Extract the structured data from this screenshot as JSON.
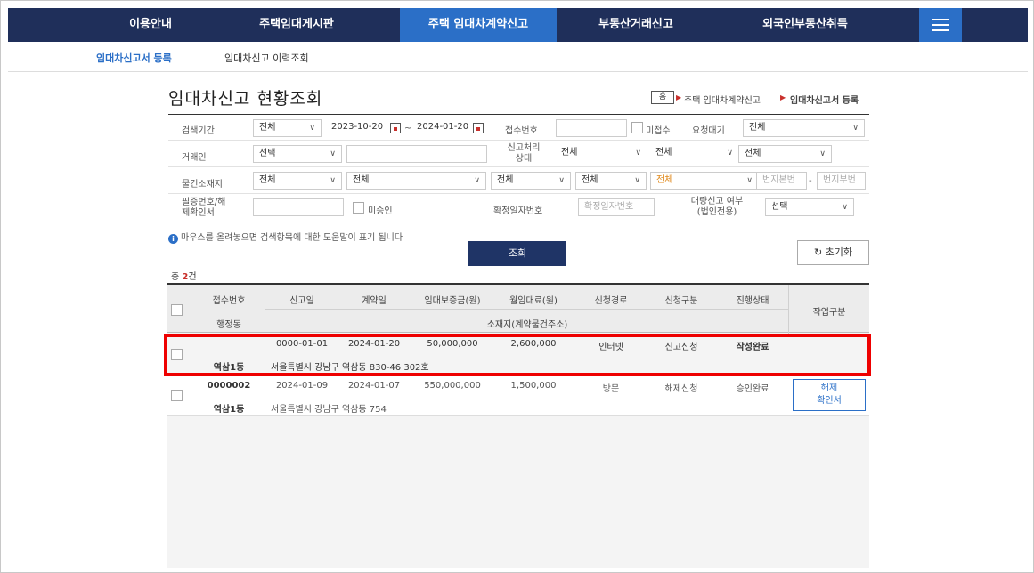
{
  "topnav": {
    "items": [
      "이용안내",
      "주택임대게시판",
      "주택 임대차계약신고",
      "부동산거래신고",
      "외국인부동산취득"
    ],
    "active_index": 2,
    "menu_icon": "hamburger-icon",
    "colors": {
      "bg": "#1f2f5a",
      "active": "#2b6fc7"
    }
  },
  "subnav": {
    "items": [
      "임대차신고서 등록",
      "임대차신고 이력조회"
    ],
    "active_index": 0
  },
  "page": {
    "title": "임대차신고 현황조회",
    "breadcrumb": {
      "home": "홈",
      "level1": "주택 임대차계약신고",
      "level2": "임대차신고서 등록"
    }
  },
  "search": {
    "period_label": "검색기간",
    "period_select": "전체",
    "date_from": "2023-10-20",
    "date_to": "2024-01-20",
    "tilde": "~",
    "receipt_label": "접수번호",
    "receipt_value": "",
    "unreceived_label": "미접수",
    "request_wait_label": "요청대기",
    "request_wait_select": "전체",
    "party_label": "거래인",
    "party_select": "선택",
    "party_value": "",
    "process_label": "신고처리 상태",
    "process_select1": "전체",
    "process_select2": "전체",
    "process_select3": "전체",
    "property_label": "물건소재지",
    "property_sido": "전체",
    "property_sigungu": "전체",
    "property_dong": "전체",
    "property_ri": "전체",
    "property_type": "전체",
    "lot_main_placeholder": "번지본번",
    "dash": "-",
    "lot_sub_placeholder": "번지부번",
    "cert_label": "필증번호/해제확인서",
    "cert_value": "",
    "unapproved_label": "미승인",
    "fixed_date_label": "확정일자번호",
    "fixed_date_placeholder": "확정일자번호",
    "bulk_label": "대량신고 여부 (법인전용)",
    "bulk_select": "선택",
    "help_text": "마우스를 올려놓으면 검색항목에 대한 도움말이 표기 됩니다",
    "search_button": "조회",
    "reset_button": "초기화"
  },
  "results": {
    "total_prefix": "총 ",
    "total_count": "2",
    "total_suffix": "건",
    "headers": {
      "receipt_no": "접수번호",
      "report_date": "신고일",
      "contract_date": "계약일",
      "deposit": "임대보증금(원)",
      "monthly_rent": "월임대료(원)",
      "channel": "신청경로",
      "request_type": "신청구분",
      "status": "진행상태",
      "admin_dong": "행정동",
      "address": "소재지(계약물건주소)",
      "task": "작업구분"
    },
    "rows": [
      {
        "receipt_no": "",
        "report_date": "0000-01-01",
        "contract_date": "2024-01-20",
        "deposit": "50,000,000",
        "monthly_rent": "2,600,000",
        "channel": "인터넷",
        "request_type": "신고신청",
        "status": "작성완료",
        "admin_dong": "역삼1동",
        "address": "서울특별시 강남구 역삼동 830-46 302호",
        "task": ""
      },
      {
        "receipt_no": "0000002",
        "report_date": "2024-01-09",
        "contract_date": "2024-01-07",
        "deposit": "550,000,000",
        "monthly_rent": "1,500,000",
        "channel": "방문",
        "request_type": "해제신청",
        "status": "승인완료",
        "admin_dong": "역삼1동",
        "address": "서울특별시 강남구 역삼동 754",
        "task_line1": "해제",
        "task_line2": "확인서"
      }
    ]
  }
}
